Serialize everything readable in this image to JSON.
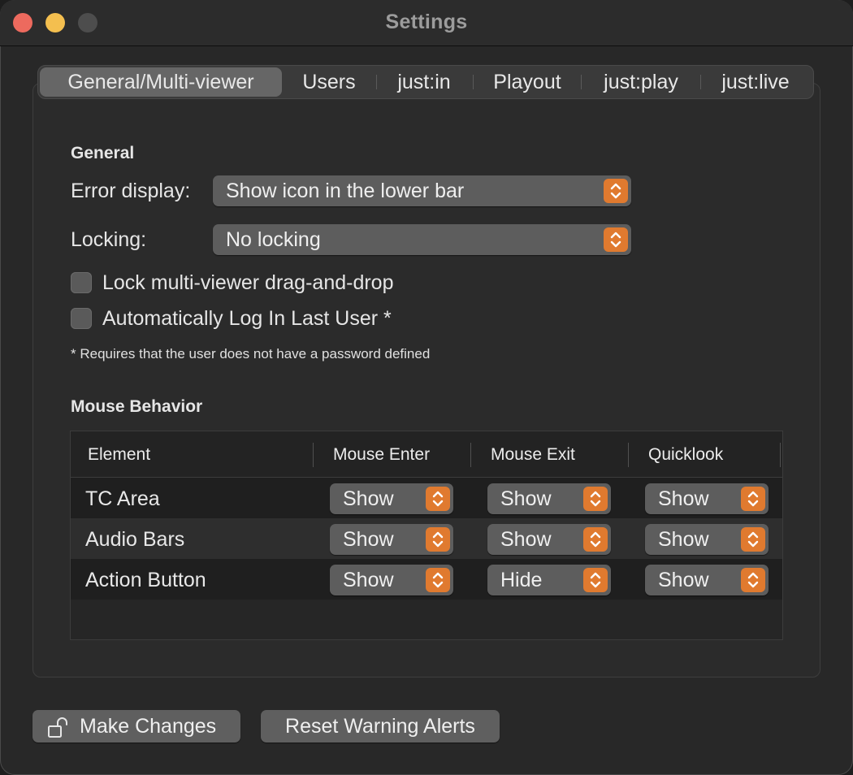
{
  "window": {
    "title": "Settings"
  },
  "tabs": [
    {
      "label": "General/Multi-viewer",
      "active": true
    },
    {
      "label": "Users",
      "active": false
    },
    {
      "label": "just:in",
      "active": false
    },
    {
      "label": "Playout",
      "active": false
    },
    {
      "label": "just:play",
      "active": false
    },
    {
      "label": "just:live",
      "active": false
    }
  ],
  "general": {
    "heading": "General",
    "error_display": {
      "label": "Error display:",
      "value": "Show icon in the lower bar"
    },
    "locking": {
      "label": "Locking:",
      "value": "No locking"
    },
    "checkboxes": [
      {
        "label": "Lock multi-viewer drag-and-drop",
        "checked": false
      },
      {
        "label": "Automatically Log In Last User *",
        "checked": false
      }
    ],
    "note": "* Requires that the user does not have a password defined"
  },
  "mouse": {
    "heading": "Mouse Behavior",
    "columns": [
      "Element",
      "Mouse Enter",
      "Mouse Exit",
      "Quicklook"
    ],
    "rows": [
      {
        "element": "TC Area",
        "enter": "Show",
        "exit": "Show",
        "quicklook": "Show"
      },
      {
        "element": "Audio Bars",
        "enter": "Show",
        "exit": "Show",
        "quicklook": "Show"
      },
      {
        "element": "Action Button",
        "enter": "Show",
        "exit": "Hide",
        "quicklook": "Show"
      }
    ]
  },
  "footer": {
    "make_changes": "Make Changes",
    "make_changes_icon": "unlock-icon",
    "reset_alerts": "Reset Warning Alerts"
  },
  "colors": {
    "accent": "#e07a2f",
    "window_bg": "#282828"
  }
}
